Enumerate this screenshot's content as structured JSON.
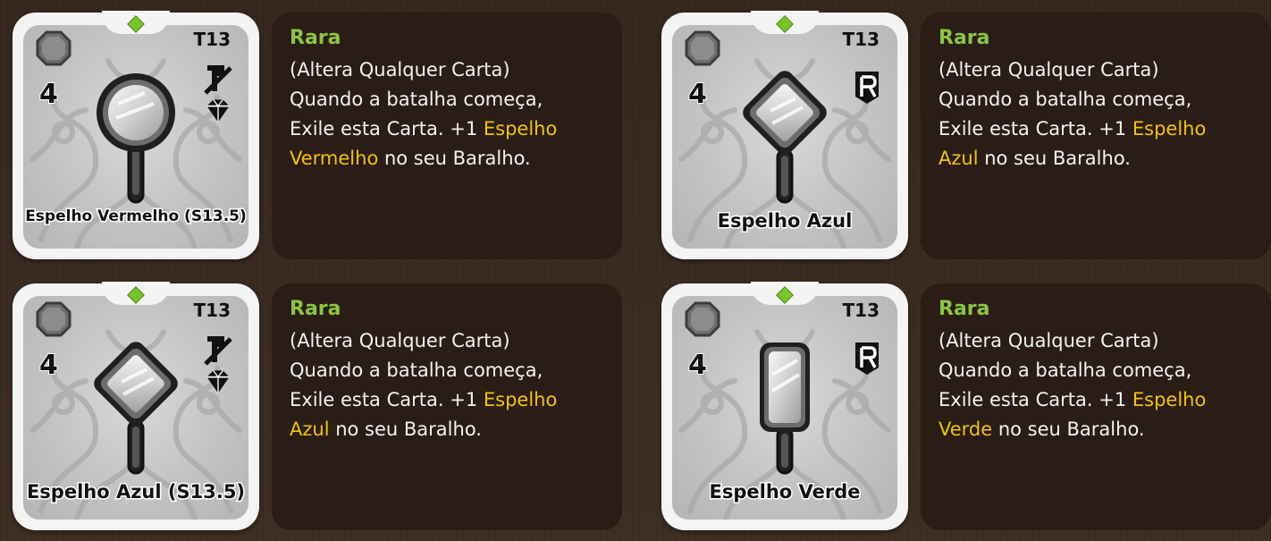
{
  "entries": [
    {
      "card": {
        "name": "Espelho Vermelho (S13.5)",
        "cost": "4",
        "tier": "T13",
        "icons": [
          "no-sword-icon",
          "diamond-icon"
        ],
        "art": "red-mirror-round-icon"
      },
      "rarity": "Rara",
      "desc": {
        "line1": "(Altera Qualquer Carta)",
        "line2": "Quando a batalha começa,",
        "line3_pre": "Exile esta Carta. +1 ",
        "line3_hl": "Espelho",
        "line4_hl": "Vermelho",
        "line4_post": " no seu Baralho."
      }
    },
    {
      "card": {
        "name": "Espelho Azul",
        "cost": "4",
        "tier": "T13",
        "icons": [
          "r-badge-icon"
        ],
        "art": "blue-mirror-diamond-icon"
      },
      "rarity": "Rara",
      "desc": {
        "line1": "(Altera Qualquer Carta)",
        "line2": "Quando a batalha começa,",
        "line3_pre": "Exile esta Carta. +1 ",
        "line3_hl": "Espelho",
        "line4_hl": "Azul",
        "line4_post": " no seu Baralho."
      }
    },
    {
      "card": {
        "name": "Espelho Azul (S13.5)",
        "cost": "4",
        "tier": "T13",
        "icons": [
          "no-sword-icon",
          "diamond-icon"
        ],
        "art": "blue-mirror-diamond-icon"
      },
      "rarity": "Rara",
      "desc": {
        "line1": "(Altera Qualquer Carta)",
        "line2": "Quando a batalha começa,",
        "line3_pre": "Exile esta Carta. +1 ",
        "line3_hl": "Espelho",
        "line4_hl": "Azul",
        "line4_post": " no seu Baralho."
      }
    },
    {
      "card": {
        "name": "Espelho Verde",
        "cost": "4",
        "tier": "T13",
        "icons": [
          "r-badge-icon"
        ],
        "art": "green-mirror-rect-icon"
      },
      "rarity": "Rara",
      "desc": {
        "line1": "(Altera Qualquer Carta)",
        "line2": "Quando a batalha começa,",
        "line3_pre": "Exile esta Carta. +1 ",
        "line3_hl": "Espelho",
        "line4_hl": "Verde",
        "line4_post": " no seu Baralho."
      }
    }
  ],
  "colors": {
    "rarity": "#8cc63f",
    "highlight": "#f2c300",
    "panel": "#2a1d15",
    "gem": "#76c62a"
  }
}
